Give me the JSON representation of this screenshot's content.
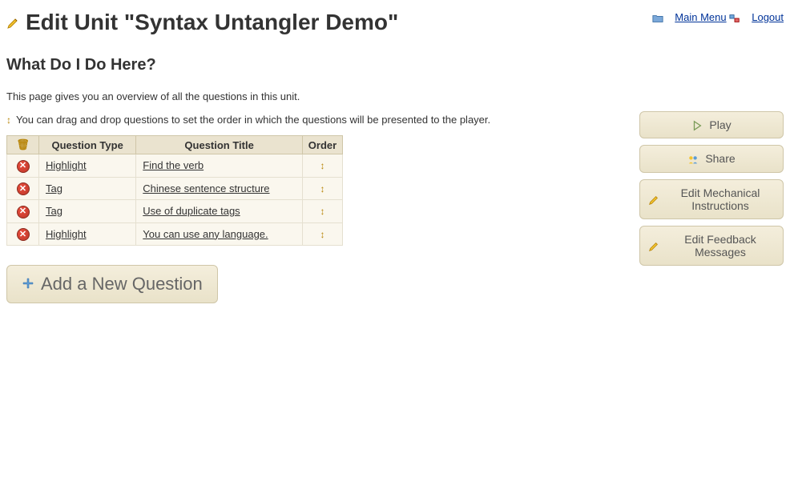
{
  "header": {
    "title": "Edit Unit \"Syntax Untangler Demo\"",
    "main_menu": "Main Menu",
    "logout": "Logout"
  },
  "subheading": "What Do I Do Here?",
  "intro": "This page gives you an overview of all the questions in this unit.",
  "drag_info": "You can drag and drop questions to set the order in which the questions will be presented to the player.",
  "table": {
    "headers": {
      "delete": "",
      "type": "Question Type",
      "title": "Question Title",
      "order": "Order"
    },
    "rows": [
      {
        "type": "Highlight",
        "title": "Find the verb"
      },
      {
        "type": "Tag",
        "title": "Chinese sentence structure"
      },
      {
        "type": "Tag",
        "title": "Use of duplicate tags"
      },
      {
        "type": "Highlight",
        "title": "You can use any language."
      }
    ]
  },
  "add_button": "Add a New Question",
  "sidebar": {
    "play": "Play",
    "share": "Share",
    "edit_mechanical": "Edit Mechanical Instructions",
    "edit_feedback": "Edit Feedback Messages"
  }
}
